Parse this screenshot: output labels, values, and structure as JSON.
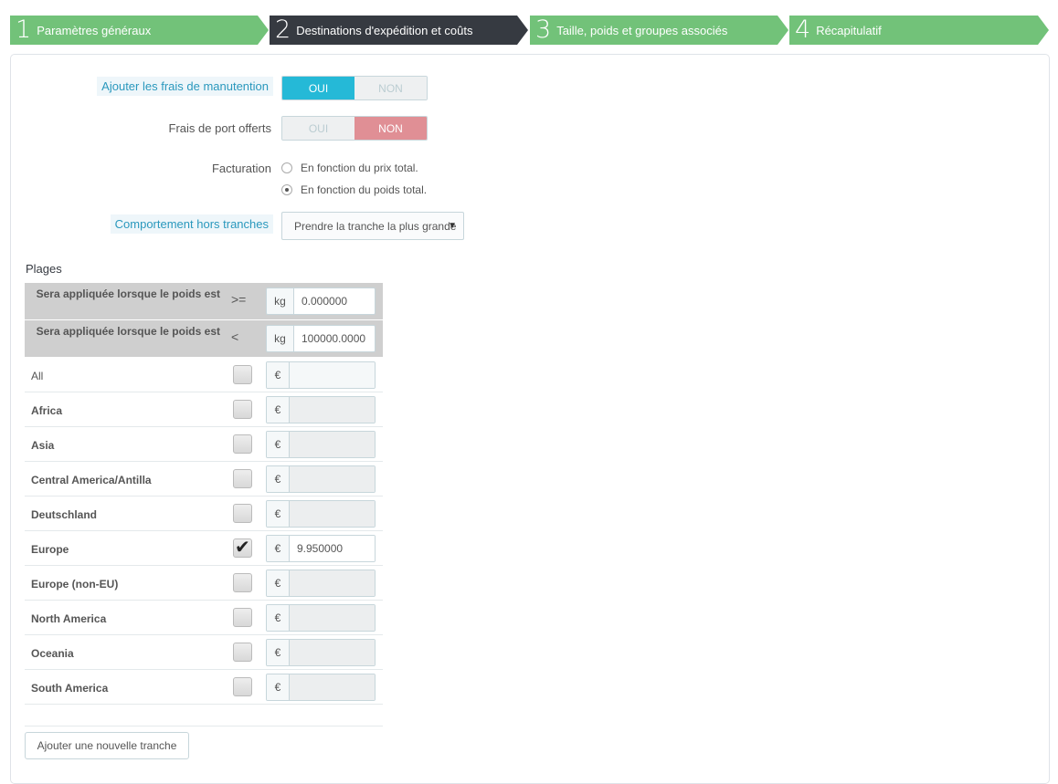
{
  "wizard": {
    "steps": [
      {
        "num": "1",
        "label": "Paramètres généraux"
      },
      {
        "num": "2",
        "label": "Destinations d'expédition et coûts"
      },
      {
        "num": "3",
        "label": "Taille, poids et groupes associés"
      },
      {
        "num": "4",
        "label": "Récapitulatif"
      }
    ],
    "active_step": 2,
    "colors": {
      "done": "#72c279",
      "active": "#363a41"
    }
  },
  "form": {
    "handling_fees": {
      "label": "Ajouter les frais de manutention",
      "yes": "OUI",
      "no": "NON",
      "value": "OUI"
    },
    "free_shipping": {
      "label": "Frais de port offerts",
      "yes": "OUI",
      "no": "NON",
      "value": "NON"
    },
    "billing": {
      "label": "Facturation",
      "options": [
        "En fonction du prix total.",
        "En fonction du poids total."
      ],
      "selected": 1
    },
    "out_of_range": {
      "label": "Comportement hors tranches",
      "value": "Prendre la tranche la plus grande"
    }
  },
  "ranges": {
    "title": "Plages",
    "rows": [
      {
        "label": "Sera appliquée lorsque le poids est",
        "operator": ">=",
        "unit": "kg",
        "value": "0.000000"
      },
      {
        "label": "Sera appliquée lorsque le poids est",
        "operator": "<",
        "unit": "kg",
        "value": "100000.0000"
      }
    ],
    "currency": "€",
    "zones": [
      {
        "name": "All",
        "checked": false,
        "price": ""
      },
      {
        "name": "Africa",
        "checked": false,
        "price": ""
      },
      {
        "name": "Asia",
        "checked": false,
        "price": ""
      },
      {
        "name": "Central America/Antilla",
        "checked": false,
        "price": ""
      },
      {
        "name": "Deutschland",
        "checked": false,
        "price": ""
      },
      {
        "name": "Europe",
        "checked": true,
        "price": "9.950000"
      },
      {
        "name": "Europe (non-EU)",
        "checked": false,
        "price": ""
      },
      {
        "name": "North America",
        "checked": false,
        "price": ""
      },
      {
        "name": "Oceania",
        "checked": false,
        "price": ""
      },
      {
        "name": "South America",
        "checked": false,
        "price": ""
      }
    ],
    "add_button": "Ajouter une nouvelle tranche"
  }
}
